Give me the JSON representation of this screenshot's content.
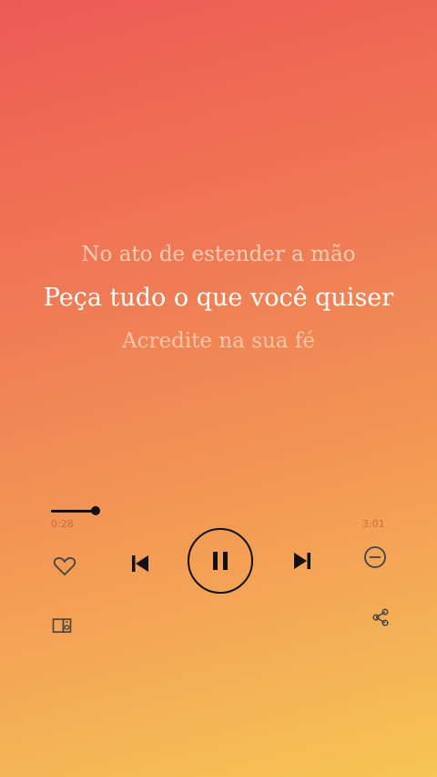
{
  "lyrics": {
    "previous": "No ato de estender a mão",
    "current": "Peça tudo o que você quiser",
    "next": "Acredite na sua fé"
  },
  "player": {
    "elapsed": "0:28",
    "total": "3:01",
    "progress_fraction": 0.16,
    "state": "playing"
  },
  "icons": {
    "like": "heart-outline-icon",
    "previous": "skip-previous-icon",
    "pause": "pause-icon",
    "next": "skip-next-icon",
    "remove": "minus-circle-icon",
    "device": "connect-device-icon",
    "share": "share-icon"
  },
  "colors": {
    "gradient_top": "#ee5a55",
    "gradient_bottom": "#f6c555",
    "current_lyric": "#ffffff",
    "controls": "#111111"
  }
}
